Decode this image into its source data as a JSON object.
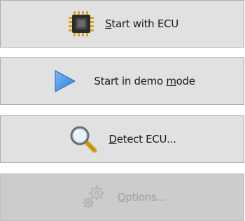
{
  "buttons": {
    "start_ecu": {
      "mnemonic": "S",
      "label_rest": "tart with ECU",
      "icon": "chip-icon",
      "enabled": true
    },
    "demo": {
      "label_pre": "Start in demo ",
      "mnemonic": "m",
      "label_post": "ode",
      "icon": "play-triangle-icon",
      "enabled": true
    },
    "detect": {
      "mnemonic": "D",
      "label_rest": "etect ECU...",
      "icon": "magnifier-icon",
      "enabled": true
    },
    "options": {
      "mnemonic": "O",
      "label_rest": "ptions...",
      "icon": "gears-icon",
      "enabled": false
    }
  },
  "colors": {
    "button_bg": "#e1e1e1",
    "button_border": "#adadad",
    "disabled_bg": "#cccccc",
    "disabled_text": "#a0a0a0",
    "play_blue": "#3d8fe8"
  }
}
